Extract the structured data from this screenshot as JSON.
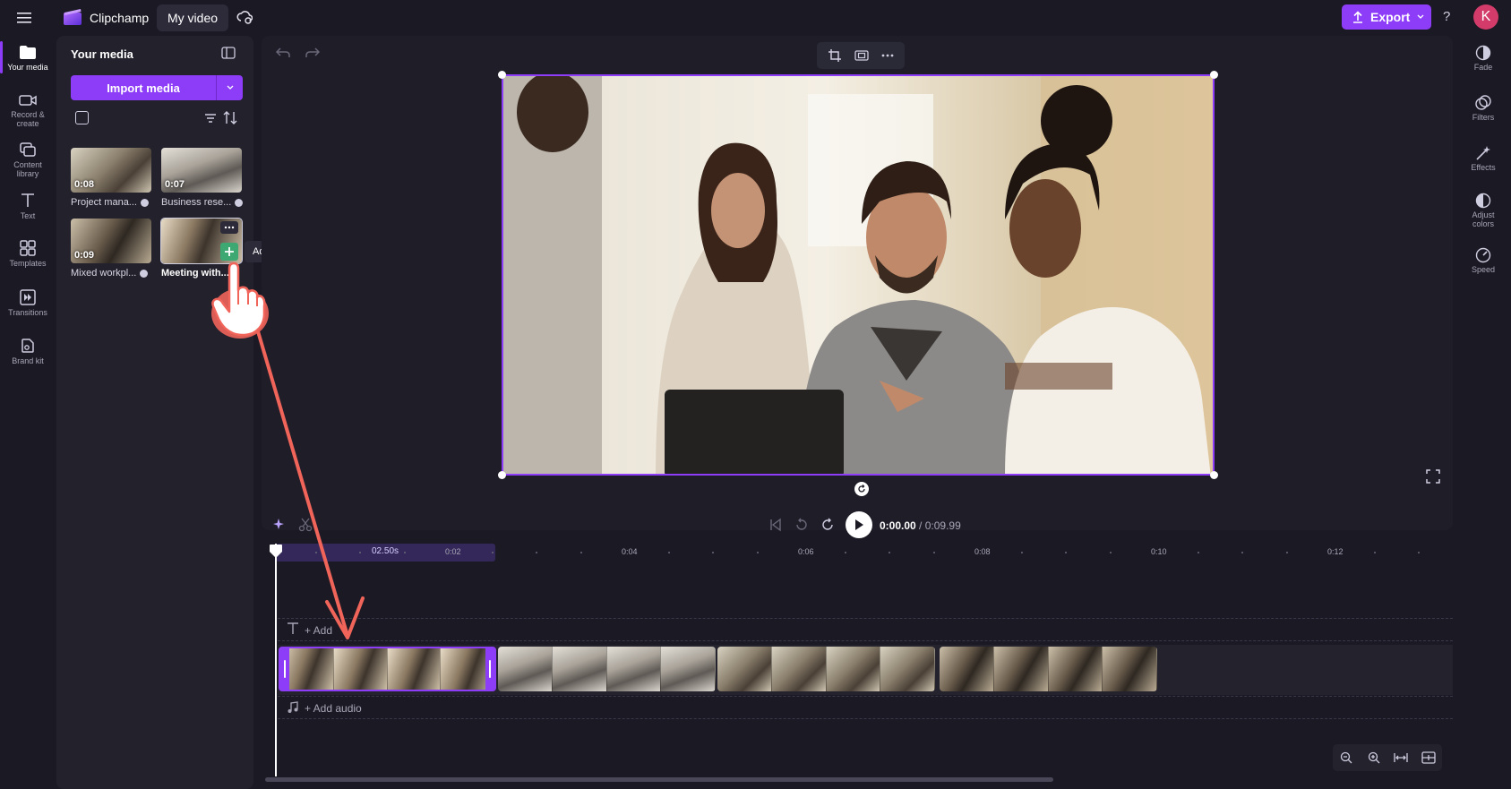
{
  "topbar": {
    "app_name": "Clipchamp",
    "project_name": "My video",
    "export_label": "Export",
    "help": "?",
    "avatar_initial": "K"
  },
  "left_rail": {
    "items": [
      {
        "label": "Your media",
        "icon": "folder-icon"
      },
      {
        "label": "Record &\ncreate",
        "icon": "camera-icon"
      },
      {
        "label": "Content\nlibrary",
        "icon": "library-icon"
      },
      {
        "label": "Text",
        "icon": "text-icon"
      },
      {
        "label": "Templates",
        "icon": "templates-icon"
      },
      {
        "label": "Transitions",
        "icon": "transitions-icon"
      },
      {
        "label": "Brand kit",
        "icon": "brand-kit-icon"
      }
    ]
  },
  "media_panel": {
    "title": "Your media",
    "import_label": "Import media",
    "items": [
      {
        "duration": "0:08",
        "name": "Project mana..."
      },
      {
        "duration": "0:07",
        "name": "Business rese..."
      },
      {
        "duration": "0:09",
        "name": "Mixed workpl..."
      },
      {
        "duration": "",
        "name": "Meeting with..."
      }
    ],
    "tooltip": "Add to timeline"
  },
  "right_rail": {
    "items": [
      {
        "label": "Fade",
        "icon": "fade-icon"
      },
      {
        "label": "Filters",
        "icon": "filters-icon"
      },
      {
        "label": "Effects",
        "icon": "effects-icon"
      },
      {
        "label": "Adjust\ncolors",
        "icon": "adjust-colors-icon"
      },
      {
        "label": "Speed",
        "icon": "speed-icon"
      }
    ]
  },
  "playback": {
    "current_time": "0:00.00",
    "total_time": "/ 0:09.99"
  },
  "timeline": {
    "selection_label": "02.50s",
    "ticks": [
      "0:02",
      "0:04",
      "0:06",
      "0:08",
      "0:10",
      "0:12"
    ],
    "text_track_label": "+ Add",
    "audio_track_label": "+ Add audio"
  },
  "colors": {
    "accent": "#8d3cf7",
    "background": "#1b1a24",
    "panel": "#22212c",
    "pointer_arrow": "#f0645a"
  }
}
